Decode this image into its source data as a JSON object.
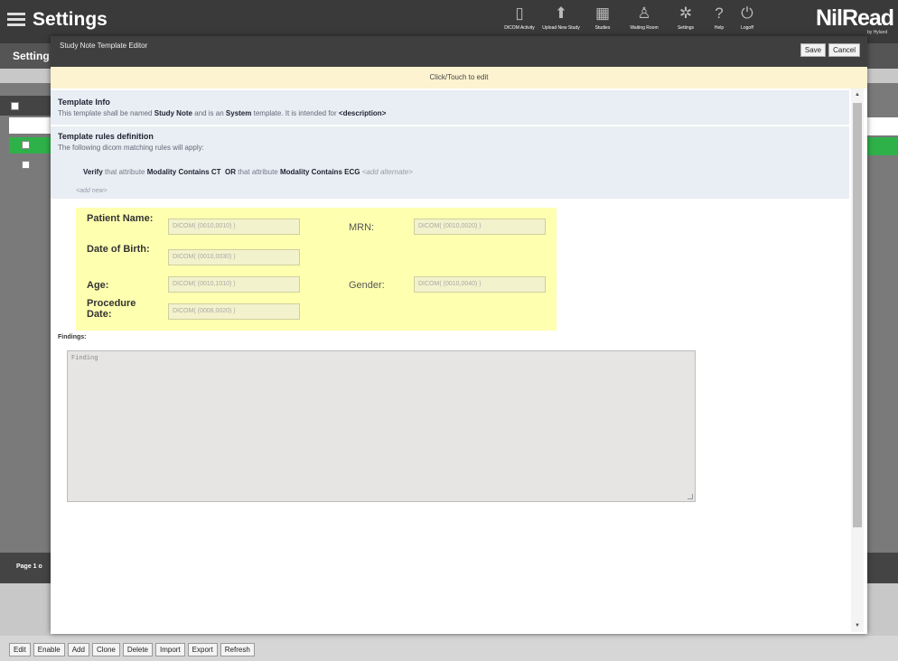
{
  "app": {
    "title": "Settings",
    "brand": "NilRead",
    "brand_sub": "by Hyland",
    "nav": [
      {
        "icon": "dicom-activity-icon",
        "glyph": "▯",
        "label": "DICOM Activity"
      },
      {
        "icon": "upload-study-icon",
        "glyph": "⬆",
        "label": "Upload New Study"
      },
      {
        "icon": "studies-icon",
        "glyph": "▦",
        "label": "Studies"
      },
      {
        "icon": "waiting-room-icon",
        "glyph": "♙",
        "label": "Waiting Room"
      },
      {
        "icon": "settings-icon",
        "glyph": "✲",
        "label": "Settings"
      },
      {
        "icon": "help-icon",
        "glyph": "?",
        "label": "Help"
      },
      {
        "icon": "logoff-icon",
        "glyph": "⏻",
        "label": "Logoff"
      }
    ]
  },
  "background": {
    "subheader": "Setting",
    "pager": "Page 1 o",
    "buttons": [
      "Edit",
      "Enable",
      "Add",
      "Clone",
      "Delete",
      "Import",
      "Export",
      "Refresh"
    ]
  },
  "modal": {
    "title": "Study Note Template Editor",
    "save": "Save",
    "cancel": "Cancel",
    "click_to_edit": "Click/Touch to edit",
    "template_info": {
      "heading": "Template Info",
      "pre": "This template shall be named",
      "name": "Study Note",
      "mid": "and is an",
      "type": "System",
      "post": "template. It is intended for",
      "description": "<description>"
    },
    "rules": {
      "heading": "Template rules definition",
      "intro": "The following dicom matching rules will apply:",
      "verify": "Verify",
      "that_attr_1": "that attribute",
      "attr_1": "Modality",
      "op_1": "Contains",
      "val_1": "CT",
      "or": "OR",
      "that_attr_2": "that attribute",
      "attr_2": "Modality",
      "op_2": "Contains",
      "val_2": "ECG",
      "add_alternate": "<add alternate>",
      "add_new": "<add new>"
    },
    "fields": {
      "patient_name_label": "Patient Name:",
      "patient_name_value": "DICOM( (0010,0010) )",
      "mrn_label": "MRN:",
      "mrn_value": "DICOM( (0010,0020) )",
      "dob_label": "Date of Birth:",
      "dob_value": "DICOM( (0010,0030) )",
      "age_label": "Age:",
      "age_value": "DICOM( (0010,1010) )",
      "gender_label": "Gender:",
      "gender_value": "DICOM( (0010,0040) )",
      "procedure_label": "Procedure Date:",
      "procedure_value": "DICOM( (0008,0020) )"
    },
    "findings_label": "Findings:",
    "findings_value": "Finding"
  }
}
